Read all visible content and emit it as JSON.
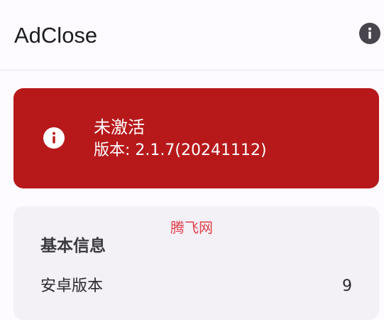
{
  "app_bar": {
    "title": "AdClose",
    "info_icon": "info-icon"
  },
  "status_card": {
    "icon": "info-icon",
    "title": "未激活",
    "version": "版本: 2.1.7(20241112)",
    "color": "#b7191b"
  },
  "watermark": "腾飞网",
  "basic_info": {
    "title": "基本信息",
    "rows": [
      {
        "label": "安卓版本",
        "value": "9"
      }
    ]
  }
}
